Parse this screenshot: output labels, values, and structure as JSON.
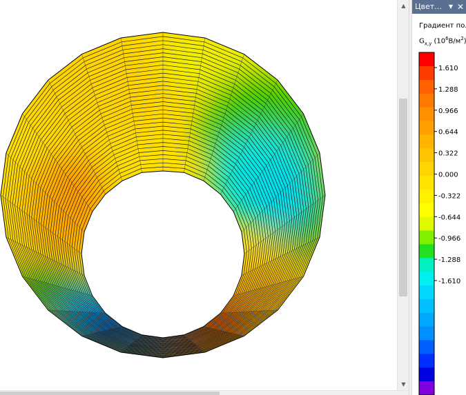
{
  "panel": {
    "title": "Цвет...",
    "pin_glyph": "▼",
    "close_glyph": "✕",
    "legend_title": "Градиент пол",
    "units_symbol": "G",
    "units_subscript": "x,y",
    "units_open": " (10",
    "units_exp": "6",
    "units_mid": "В/м",
    "units_exp2": "2",
    "units_close": ")"
  },
  "scrollbar": {
    "up_glyph": "▲",
    "down_glyph": "▼"
  },
  "legend": {
    "labels": [
      "1.610",
      "1.288",
      "0.966",
      "0.644",
      "0.322",
      "0.000",
      "-0.322",
      "-0.644",
      "-0.966",
      "-1.288",
      "-1.610"
    ],
    "colors": [
      "#ff0000",
      "#ff3c00",
      "#ff6000",
      "#ff7800",
      "#ff9000",
      "#ffa000",
      "#ffb400",
      "#ffc400",
      "#ffd400",
      "#ffe400",
      "#fff000",
      "#ffff00",
      "#e0f800",
      "#80f000",
      "#20e020",
      "#00f0c0",
      "#00f0f0",
      "#00d8ff",
      "#00c0ff",
      "#00a8ff",
      "#0090ff",
      "#0060ff",
      "#0030ff",
      "#0000e0",
      "#8000e0"
    ]
  }
}
